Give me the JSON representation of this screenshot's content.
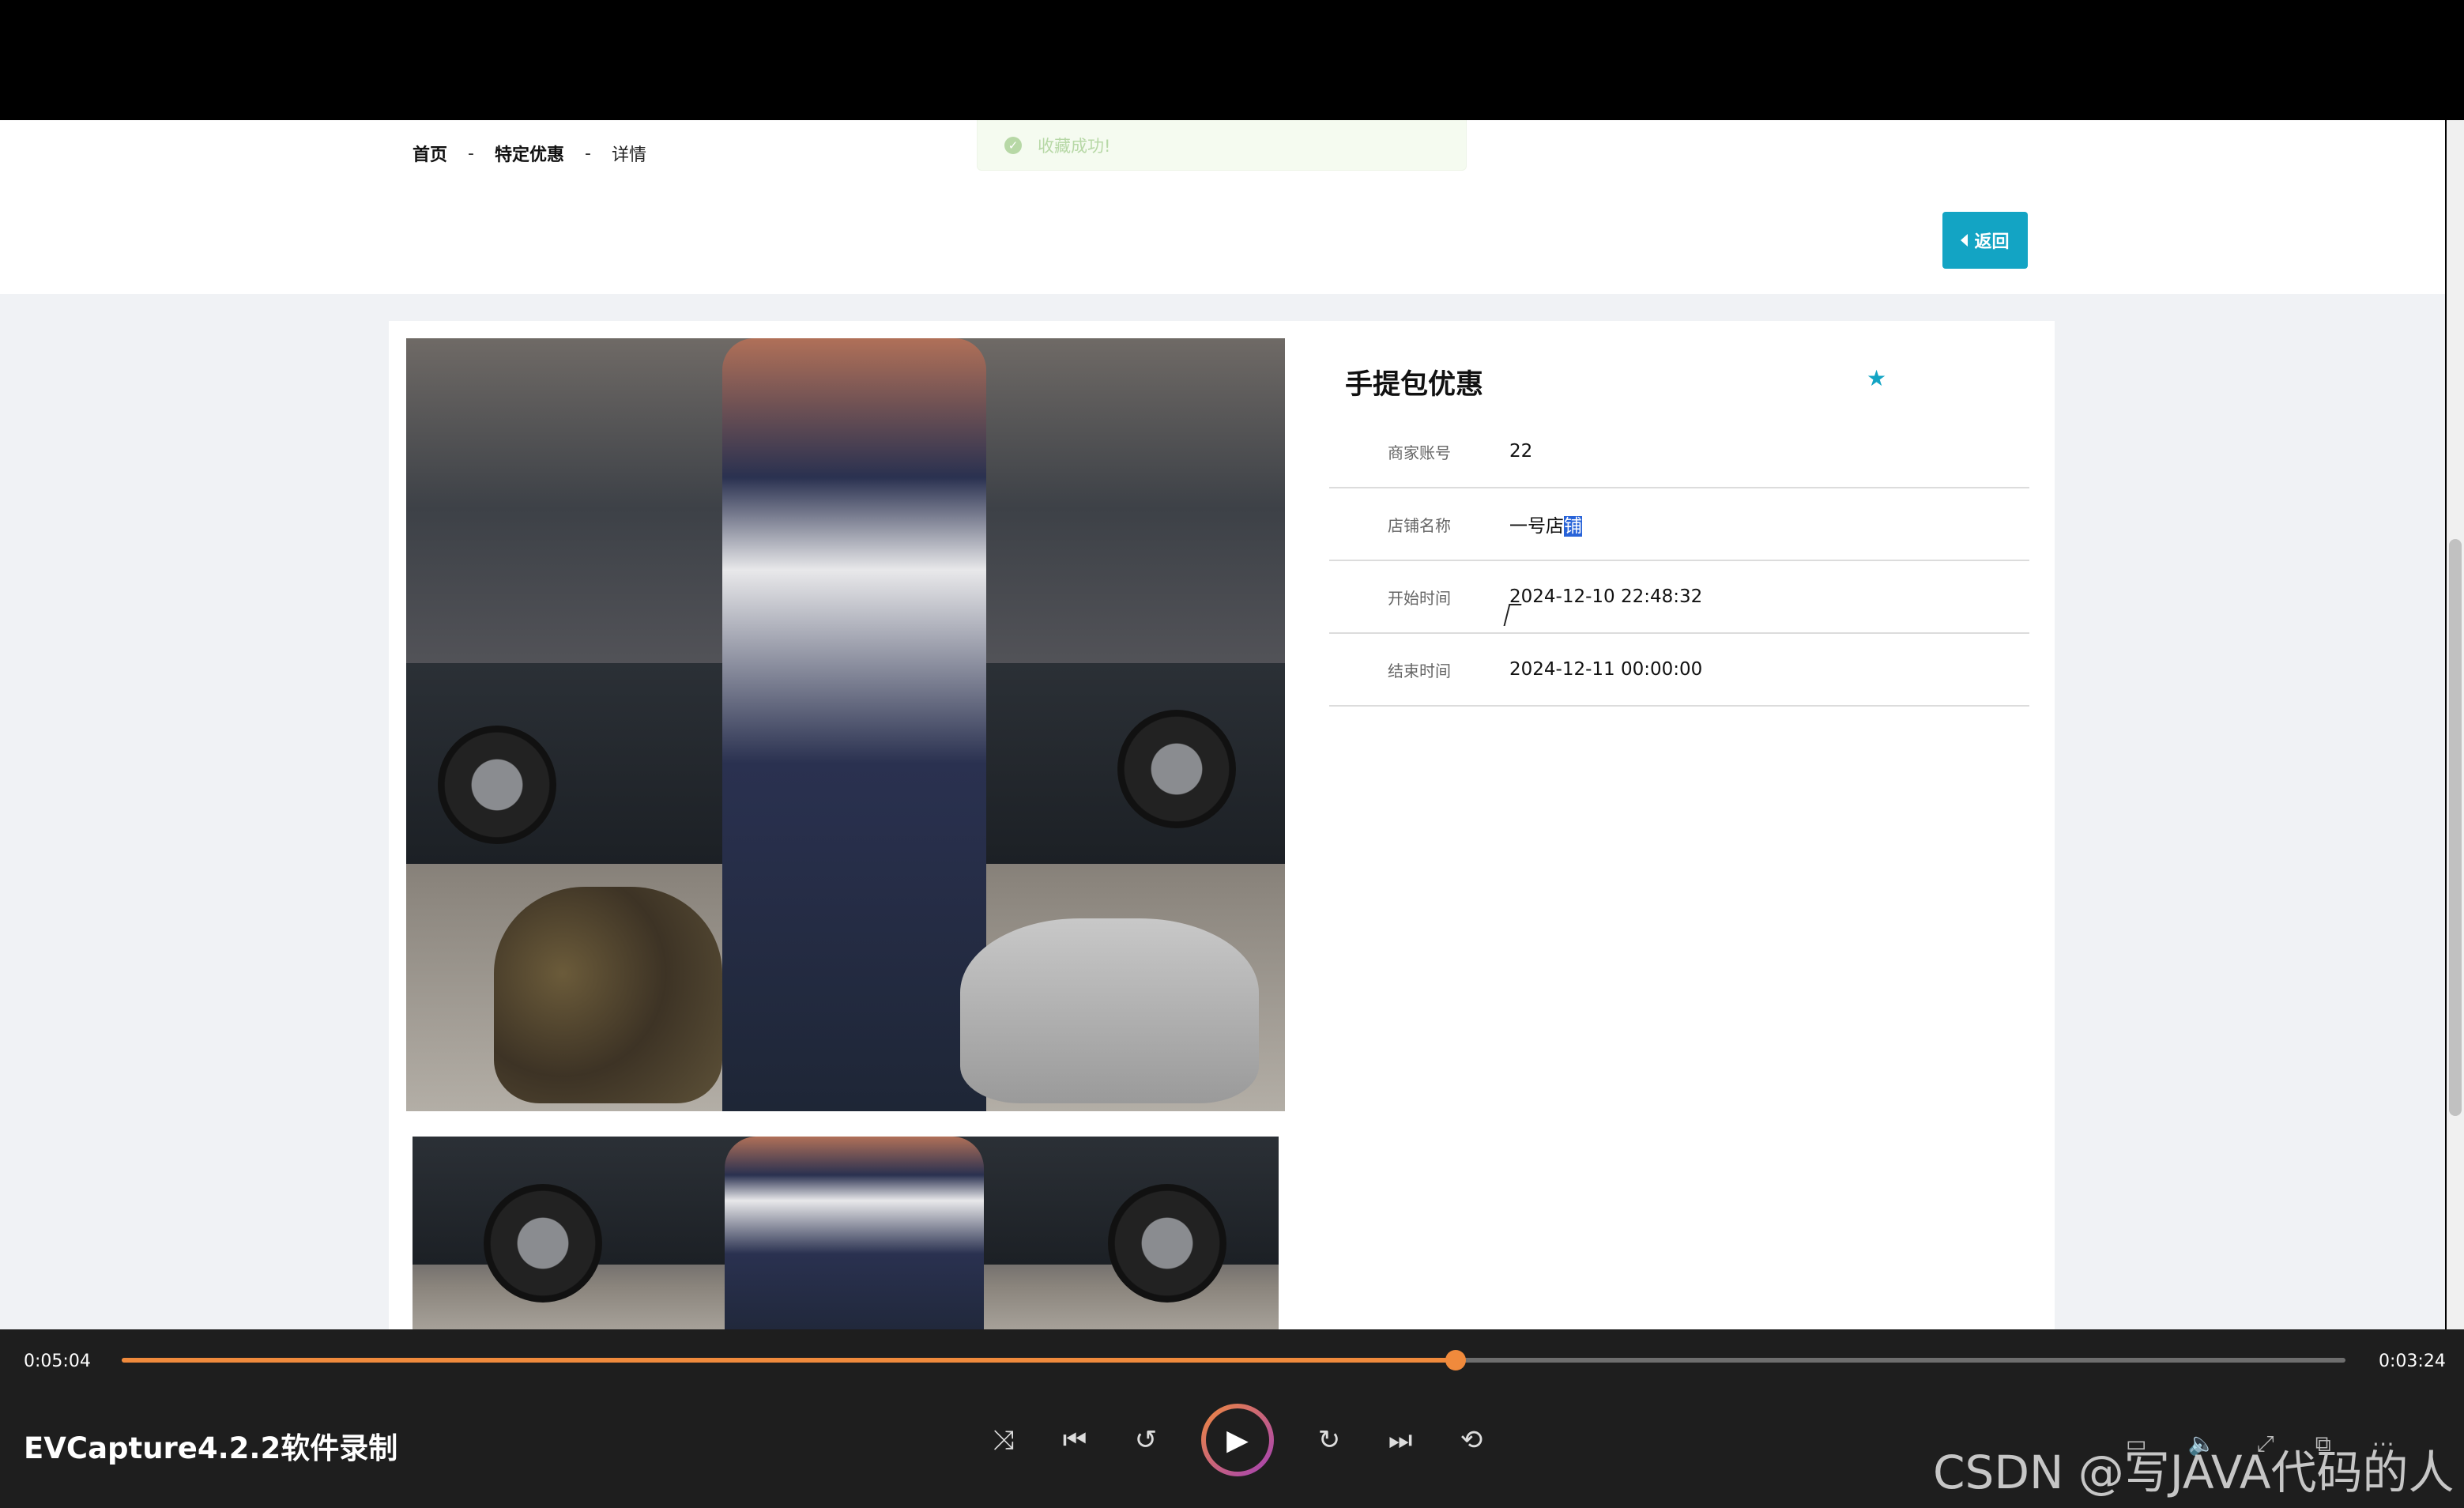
{
  "breadcrumb": {
    "home": "首页",
    "section": "特定优惠",
    "current": "详情",
    "separator": "-"
  },
  "toast": {
    "message": "收藏成功!"
  },
  "header": {
    "back_label": "返回"
  },
  "detail": {
    "title": "手提包优惠",
    "fields": [
      {
        "label": "商家账号",
        "value": "22"
      },
      {
        "label": "店铺名称",
        "value": "一号店",
        "selected": "铺"
      },
      {
        "label": "开始时间",
        "value": "2024-12-10 22:48:32"
      },
      {
        "label": "结束时间",
        "value": "2024-12-11 00:00:00"
      }
    ]
  },
  "player": {
    "elapsed": "0:05:04",
    "remaining": "0:03:24",
    "progress": 0.6,
    "app_title": "EVCapture4.2.2软件录制",
    "accent_color": "#f08a3c"
  },
  "watermark": "CSDN @写JAVA代码的人",
  "colors": {
    "brand": "#13a4c4",
    "selection": "#2863d8"
  },
  "icons": [
    "check-circle-icon",
    "caret-left-icon",
    "star-icon",
    "shuffle-icon",
    "skip-previous-icon",
    "rewind-10-icon",
    "play-icon",
    "forward-30-icon",
    "skip-next-icon",
    "repeat-icon",
    "subtitles-icon",
    "volume-icon",
    "fullscreen-icon",
    "pip-icon",
    "more-icon"
  ]
}
